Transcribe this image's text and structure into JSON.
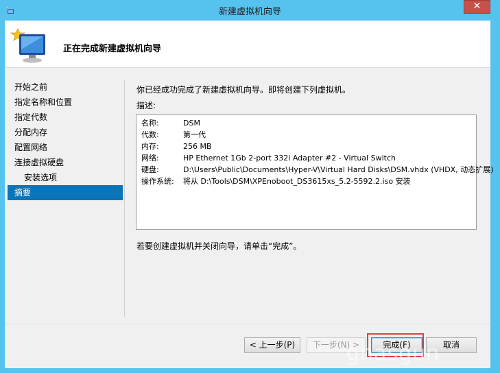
{
  "window": {
    "title": "新建虚拟机向导",
    "close_label": "✕"
  },
  "header": {
    "title": "正在完成新建虚拟机向导",
    "icon": "virtual-machine-icon"
  },
  "sidebar": {
    "items": [
      {
        "label": "开始之前"
      },
      {
        "label": "指定名称和位置"
      },
      {
        "label": "指定代数"
      },
      {
        "label": "分配内存"
      },
      {
        "label": "配置网络"
      },
      {
        "label": "连接虚拟硬盘"
      },
      {
        "label": "安装选项"
      },
      {
        "label": "摘要"
      }
    ],
    "active_index": 7
  },
  "main": {
    "intro": "你已经成功完成了新建虚拟机向导。即将创建下列虚拟机。",
    "description_label": "描述:",
    "summary": [
      {
        "key": "名称:",
        "value": "DSM"
      },
      {
        "key": "代数:",
        "value": "第一代"
      },
      {
        "key": "内存:",
        "value": "256 MB"
      },
      {
        "key": "网络:",
        "value": "HP Ethernet 1Gb 2-port 332i Adapter #2 - Virtual Switch"
      },
      {
        "key": "硬盘:",
        "value": "D:\\Users\\Public\\Documents\\Hyper-V\\Virtual Hard Disks\\DSM.vhdx (VHDX, 动态扩展)"
      },
      {
        "key": "操作系统:",
        "value": "将从 D:\\Tools\\DSM\\XPEnoboot_DS3615xs_5.2-5592.2.iso 安装"
      }
    ],
    "hint": "若要创建虚拟机并关闭向导，请单击“完成”。"
  },
  "buttons": {
    "prev": "< 上一步(P)",
    "next": "下一步(N) >",
    "finish": "完成(F)",
    "cancel": "取消"
  },
  "watermark": "gnasgun",
  "colors": {
    "accent": "#0b75b9",
    "frame": "#56c3ee",
    "highlight": "#e04040"
  }
}
